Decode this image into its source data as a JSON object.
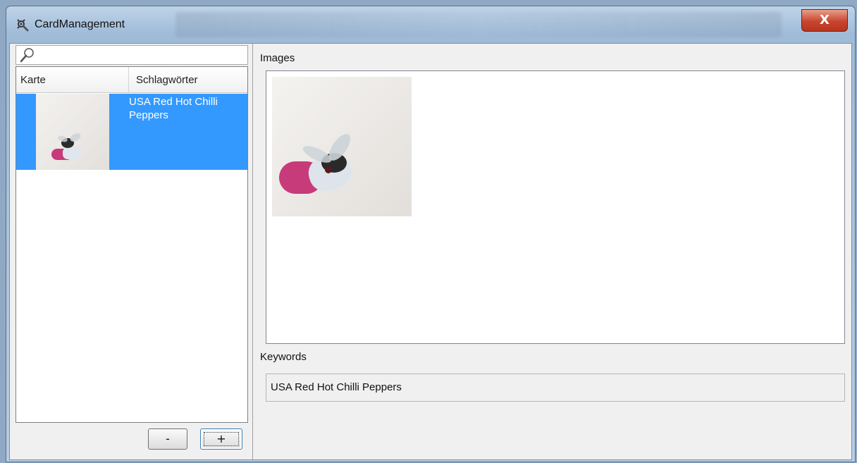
{
  "window": {
    "title": "CardManagement",
    "app_icon": "gear-wrench-icon",
    "close_label": "X"
  },
  "left_panel": {
    "search": {
      "value": "",
      "placeholder": "",
      "icon": "search-icon"
    },
    "table": {
      "columns": [
        "Karte",
        "Schlagwörter"
      ],
      "rows": [
        {
          "card_image": "album-cover-fly-on-pill",
          "keywords_line1": "USA Red Hot Chilli",
          "keywords_line2": "Peppers",
          "selected": true
        }
      ]
    },
    "buttons": {
      "remove_label": "-",
      "add_label": "+"
    }
  },
  "right_panel": {
    "images_label": "Images",
    "keywords_label": "Keywords",
    "keywords_value": "USA Red Hot Chilli Peppers"
  },
  "colors": {
    "selection": "#3399ff",
    "client_background": "#f0f0f0",
    "close_button": "#c8452e"
  }
}
